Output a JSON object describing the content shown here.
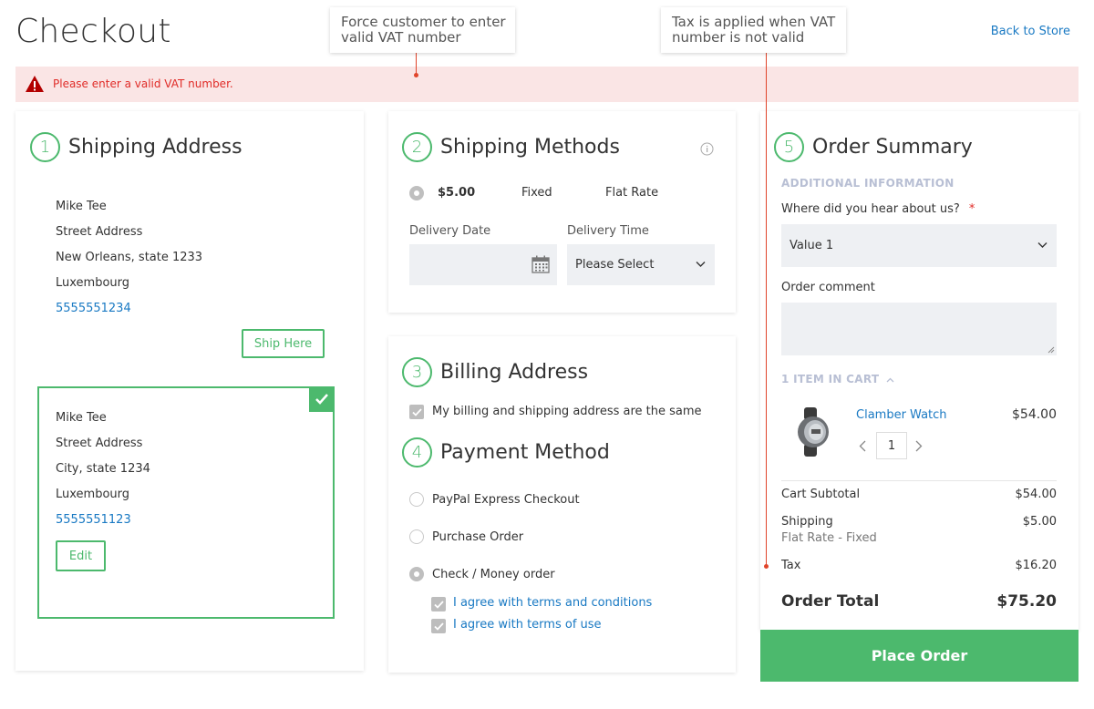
{
  "header": {
    "title": "Checkout",
    "back_link": "Back to Store"
  },
  "callouts": [
    {
      "text_line1": "Force customer to enter",
      "text_line2": "valid VAT number"
    },
    {
      "text_line1": "Tax is applied when VAT",
      "text_line2": "number is not valid"
    }
  ],
  "error": {
    "message": "Please enter a valid VAT number."
  },
  "shipping_address": {
    "step": "1",
    "title": "Shipping Address",
    "address1": {
      "name": "Mike Tee",
      "street": "Street Address",
      "city": "New Orleans, state 1233",
      "country": "Luxembourg",
      "phone": "5555551234"
    },
    "ship_here_label": "Ship Here",
    "address2": {
      "name": "Mike Tee",
      "street": "Street Address",
      "city": "City, state 1234",
      "country": "Luxembourg",
      "phone": "5555551123"
    },
    "edit_label": "Edit"
  },
  "shipping_methods": {
    "step": "2",
    "title": "Shipping Methods",
    "method": {
      "price": "$5.00",
      "type": "Fixed",
      "carrier": "Flat Rate"
    },
    "delivery_date_label": "Delivery Date",
    "delivery_time_label": "Delivery Time",
    "delivery_time_value": "Please Select"
  },
  "billing": {
    "step": "3",
    "title": "Billing Address",
    "same_label": "My billing and shipping address are the same"
  },
  "payment": {
    "step": "4",
    "title": "Payment Method",
    "options": [
      "PayPal Express Checkout",
      "Purchase Order",
      "Check / Money order"
    ],
    "selected": "Check / Money order",
    "agree1": "I agree with terms and conditions",
    "agree2": "I agree with terms of use"
  },
  "summary": {
    "step": "5",
    "title": "Order Summary",
    "additional_info": "ADDITIONAL INFORMATION",
    "hear_label": "Where did you hear about us?",
    "required_mark": "*",
    "hear_value": "Value 1",
    "comment_label": "Order comment",
    "items_in_cart": "1 ITEM IN CART",
    "item": {
      "name": "Clamber Watch",
      "price": "$54.00",
      "qty": "1"
    },
    "subtotal_label": "Cart Subtotal",
    "subtotal_value": "$54.00",
    "shipping_label": "Shipping",
    "shipping_method": "Flat Rate - Fixed",
    "shipping_value": "$5.00",
    "tax_label": "Tax",
    "tax_value": "$16.20",
    "total_label": "Order Total",
    "total_value": "$75.20",
    "place_order": "Place Order"
  },
  "colors": {
    "accent": "#4cb96d",
    "link": "#1979c3",
    "error_bg": "#fae5e5",
    "error_text": "#e02b27",
    "callout_line": "#e0442a"
  }
}
